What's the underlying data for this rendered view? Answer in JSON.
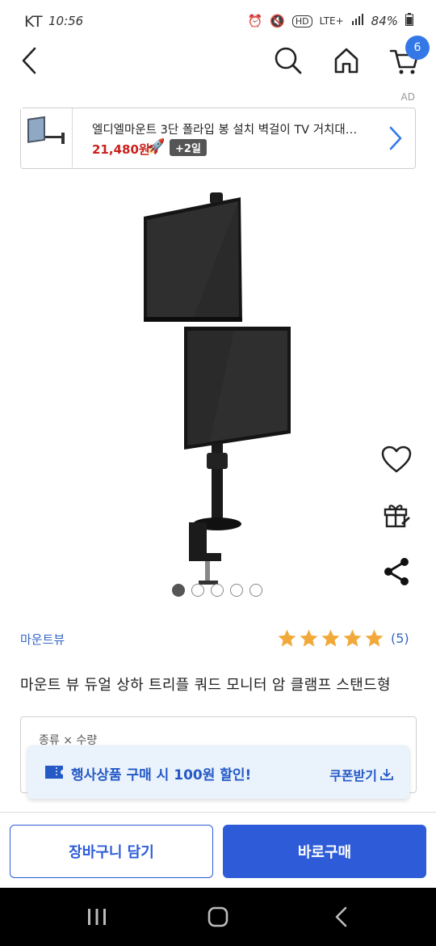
{
  "status_bar": {
    "carrier": "KT",
    "time": "10:56",
    "network": "LTE+",
    "battery": "84%"
  },
  "header": {
    "cart_count": "6",
    "icons": [
      "back-icon",
      "search-icon",
      "home-icon",
      "cart-icon"
    ]
  },
  "ad": {
    "label": "AD",
    "title": "엘디엘마운트 3단 폴라입 봉 설치 벽걸이 TV 거치대…",
    "price": "21,480원",
    "delivery_badge": "+2일"
  },
  "product": {
    "image_count": 5,
    "active_image": 0,
    "brand": "마운트뷰",
    "rating_stars": 5,
    "rating_count": "(5)",
    "title": "마운트 뷰 듀얼 상하 트리플 쿼드 모니터 암 클램프 스탠드형"
  },
  "options": {
    "label": "종류 × 수량"
  },
  "coupon": {
    "text": "행사상품 구매 시 100원 할인!",
    "action": "쿠폰받기"
  },
  "actions": {
    "add_to_cart": "장바구니 담기",
    "buy_now": "바로구매"
  },
  "colors": {
    "accent": "#2e5cd9",
    "badge": "#3478e8",
    "price": "#c9221e",
    "star": "#f2a93b",
    "link": "#3567c6"
  }
}
